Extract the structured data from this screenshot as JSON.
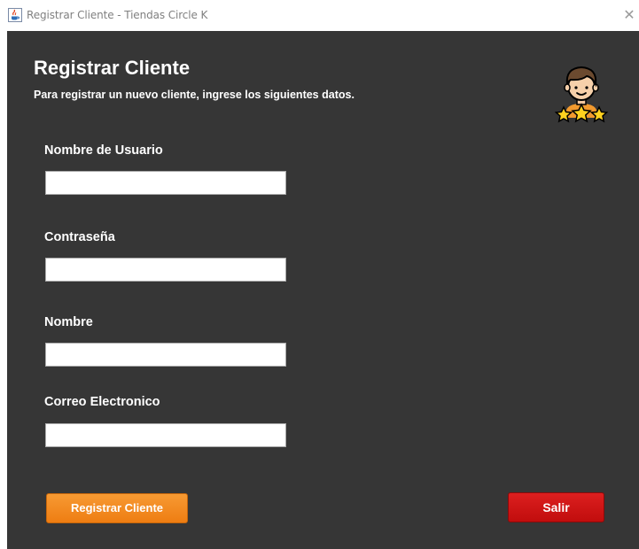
{
  "window": {
    "title": "Registrar Cliente - Tiendas Circle K",
    "close_glyph": "✕"
  },
  "header": {
    "title": "Registrar Cliente",
    "subtitle": "Para registrar un nuevo cliente, ingrese los siguientes datos."
  },
  "icons": {
    "app": "java-icon",
    "avatar": "customer-stars-icon"
  },
  "form": {
    "fields": [
      {
        "label": "Nombre de Usuario",
        "value": ""
      },
      {
        "label": "Contraseña",
        "value": ""
      },
      {
        "label": "Nombre",
        "value": ""
      },
      {
        "label": "Correo Electronico",
        "value": ""
      }
    ]
  },
  "buttons": {
    "register_label": "Registrar Cliente",
    "exit_label": "Salir"
  },
  "colors": {
    "panel_background": "#363636",
    "register_button": "#f28a1f",
    "exit_button": "#cf1515"
  }
}
